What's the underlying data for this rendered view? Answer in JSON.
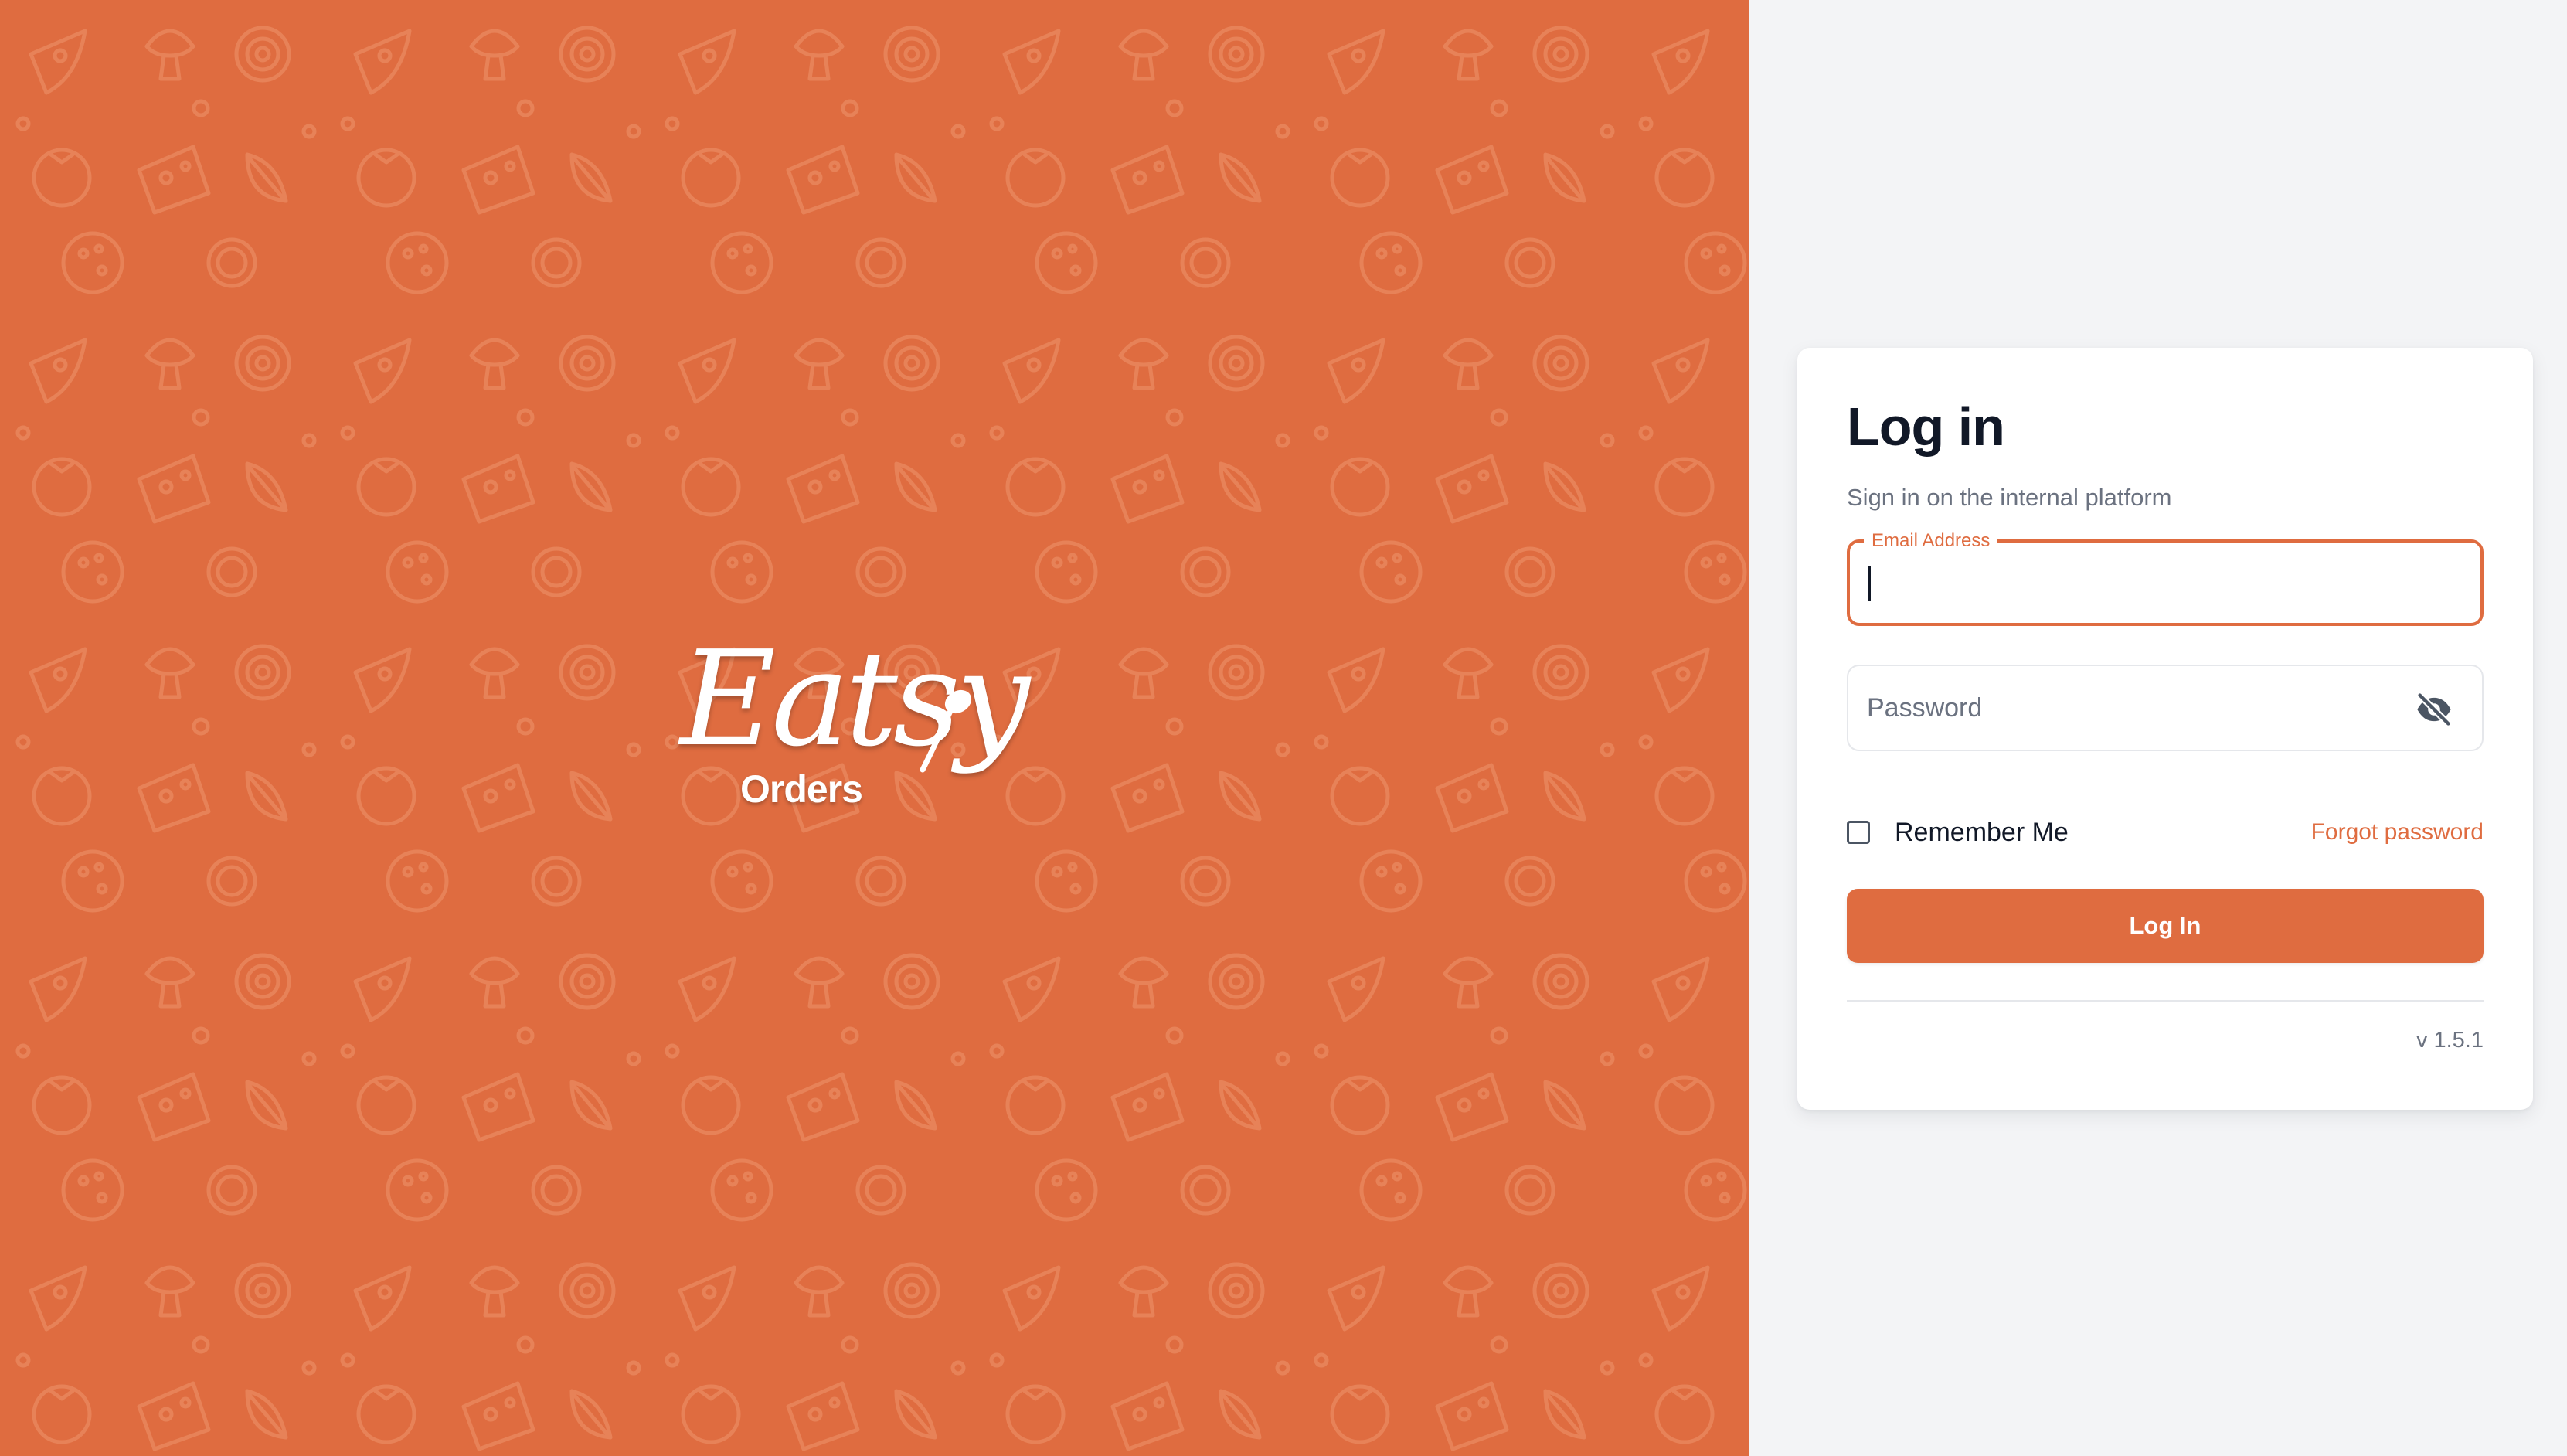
{
  "brand": {
    "logo_script": "Eatsy",
    "logo_sub": "Orders",
    "background_color": "#df6c40"
  },
  "login": {
    "title": "Log in",
    "subtitle": "Sign in on the internal platform",
    "email_label": "Email Address",
    "email_value": "",
    "password_placeholder": "Password",
    "password_value": "",
    "password_toggle_icon": "eye-off-icon",
    "remember_label": "Remember Me",
    "remember_checked": false,
    "forgot_label": "Forgot password",
    "submit_label": "Log In",
    "version": "v 1.5.1"
  },
  "colors": {
    "accent": "#df6c40",
    "page_background": "#f3f4f6",
    "card_background": "#ffffff",
    "title_text": "#111827",
    "muted_text": "#6b7280"
  }
}
